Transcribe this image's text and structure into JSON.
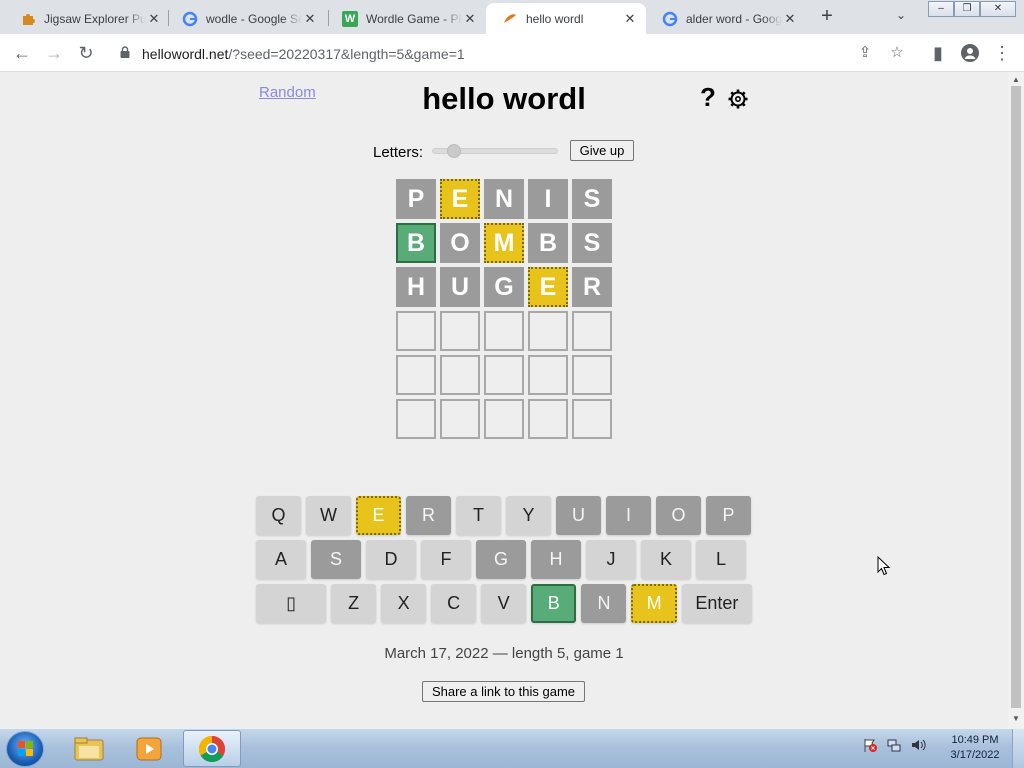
{
  "browser": {
    "tabs": [
      {
        "title": "Jigsaw Explorer Pu",
        "icon": "jigsaw-favicon-icon",
        "active": false
      },
      {
        "title": "wodle - Google Se",
        "icon": "google-favicon-icon",
        "active": false
      },
      {
        "title": "Wordle Game - Pl",
        "icon": "wordle-favicon-icon",
        "active": false
      },
      {
        "title": "hello wordl",
        "icon": "hello-wordl-favicon-icon",
        "active": true
      },
      {
        "title": "alder word - Goog",
        "icon": "google-favicon-icon",
        "active": false
      }
    ],
    "url_host": "hellowordl.net",
    "url_path": "/?seed=20220317&length=5&game=1"
  },
  "page": {
    "random_link": "Random",
    "title": "hello wordl",
    "help_label": "?",
    "letters_label": "Letters:",
    "letters_value": 5,
    "give_up_label": "Give up",
    "game_info": "March 17, 2022 — length 5, game 1",
    "share_label": "Share a link to this game"
  },
  "board": {
    "rows": [
      [
        {
          "letter": "P",
          "state": "absent"
        },
        {
          "letter": "E",
          "state": "elsewhere"
        },
        {
          "letter": "N",
          "state": "absent"
        },
        {
          "letter": "I",
          "state": "absent"
        },
        {
          "letter": "S",
          "state": "absent"
        }
      ],
      [
        {
          "letter": "B",
          "state": "correct"
        },
        {
          "letter": "O",
          "state": "absent"
        },
        {
          "letter": "M",
          "state": "elsewhere"
        },
        {
          "letter": "B",
          "state": "absent"
        },
        {
          "letter": "S",
          "state": "absent"
        }
      ],
      [
        {
          "letter": "H",
          "state": "absent"
        },
        {
          "letter": "U",
          "state": "absent"
        },
        {
          "letter": "G",
          "state": "absent"
        },
        {
          "letter": "E",
          "state": "elsewhere"
        },
        {
          "letter": "R",
          "state": "absent"
        }
      ],
      [
        {
          "letter": "",
          "state": "empty"
        },
        {
          "letter": "",
          "state": "empty"
        },
        {
          "letter": "",
          "state": "empty"
        },
        {
          "letter": "",
          "state": "empty"
        },
        {
          "letter": "",
          "state": "empty"
        }
      ],
      [
        {
          "letter": "",
          "state": "empty"
        },
        {
          "letter": "",
          "state": "empty"
        },
        {
          "letter": "",
          "state": "empty"
        },
        {
          "letter": "",
          "state": "empty"
        },
        {
          "letter": "",
          "state": "empty"
        }
      ],
      [
        {
          "letter": "",
          "state": "empty"
        },
        {
          "letter": "",
          "state": "empty"
        },
        {
          "letter": "",
          "state": "empty"
        },
        {
          "letter": "",
          "state": "empty"
        },
        {
          "letter": "",
          "state": "empty"
        }
      ]
    ]
  },
  "keyboard": {
    "rows": [
      [
        {
          "label": "Q",
          "state": "unused"
        },
        {
          "label": "W",
          "state": "unused"
        },
        {
          "label": "E",
          "state": "elsewhere"
        },
        {
          "label": "R",
          "state": "absent"
        },
        {
          "label": "T",
          "state": "unused"
        },
        {
          "label": "Y",
          "state": "unused"
        },
        {
          "label": "U",
          "state": "absent"
        },
        {
          "label": "I",
          "state": "absent"
        },
        {
          "label": "O",
          "state": "absent"
        },
        {
          "label": "P",
          "state": "absent"
        }
      ],
      [
        {
          "label": "A",
          "state": "unused"
        },
        {
          "label": "S",
          "state": "absent"
        },
        {
          "label": "D",
          "state": "unused"
        },
        {
          "label": "F",
          "state": "unused"
        },
        {
          "label": "G",
          "state": "absent"
        },
        {
          "label": "H",
          "state": "absent"
        },
        {
          "label": "J",
          "state": "unused"
        },
        {
          "label": "K",
          "state": "unused"
        },
        {
          "label": "L",
          "state": "unused"
        }
      ],
      [
        {
          "label": "▯",
          "state": "unused",
          "wide": true,
          "name": "backspace-key"
        },
        {
          "label": "Z",
          "state": "unused"
        },
        {
          "label": "X",
          "state": "unused"
        },
        {
          "label": "C",
          "state": "unused"
        },
        {
          "label": "V",
          "state": "unused"
        },
        {
          "label": "B",
          "state": "correct"
        },
        {
          "label": "N",
          "state": "absent"
        },
        {
          "label": "M",
          "state": "elsewhere"
        },
        {
          "label": "Enter",
          "state": "unused",
          "wide": true,
          "name": "enter-key"
        }
      ]
    ]
  },
  "taskbar": {
    "pinned": [
      {
        "name": "windows-explorer-icon",
        "active": false
      },
      {
        "name": "media-player-icon",
        "active": false
      },
      {
        "name": "chrome-icon",
        "active": true
      }
    ],
    "clock_time": "10:49 PM",
    "clock_date": "3/17/2022"
  },
  "colors": {
    "correct": "#57ac78",
    "elsewhere": "#e7c31b",
    "absent": "#9b9b9b",
    "key_unused": "#d4d4d4"
  }
}
